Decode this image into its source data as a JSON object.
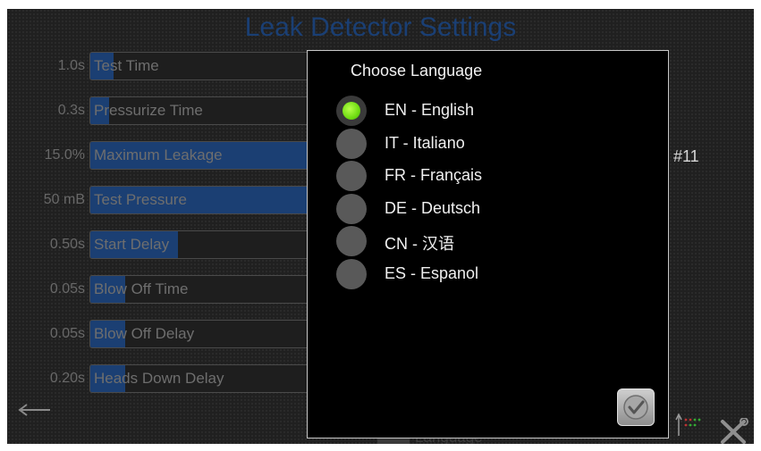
{
  "screen": {
    "title": "Leak Detector Settings",
    "side_id": "#11",
    "back_icon": "arrow-left-icon",
    "language_button_label": "Language",
    "tools_icon": "tools-icon",
    "status_icon": "signal-status-icon"
  },
  "settings": [
    {
      "value": "1.0s",
      "label": "Test Time",
      "level_pct": 10
    },
    {
      "value": "0.3s",
      "label": "Pressurize Time",
      "level_pct": 8
    },
    {
      "value": "15.0%",
      "label": "Maximum Leakage",
      "level_pct": 95
    },
    {
      "value": "50 mB",
      "label": "Test Pressure",
      "level_pct": 95
    },
    {
      "value": "0.50s",
      "label": "Start Delay",
      "level_pct": 38
    },
    {
      "value": "0.05s",
      "label": "Blow Off Time",
      "level_pct": 15
    },
    {
      "value": "0.05s",
      "label": "Blow Off Delay",
      "level_pct": 15
    },
    {
      "value": "0.20s",
      "label": "Heads Down Delay",
      "level_pct": 15
    }
  ],
  "dialog": {
    "title": "Choose Language",
    "ok_icon": "checkmark-icon",
    "options": [
      {
        "label": "EN - English",
        "selected": true
      },
      {
        "label": "IT - Italiano",
        "selected": false
      },
      {
        "label": "FR - Français",
        "selected": false
      },
      {
        "label": "DE - Deutsch",
        "selected": false
      },
      {
        "label": "CN - 汉语",
        "selected": false
      },
      {
        "label": "ES - Espanol",
        "selected": false
      }
    ]
  },
  "colors": {
    "accent_fill": "#1b3f73",
    "selected_radio": "#7ee81a",
    "title": "#1a3f74"
  }
}
